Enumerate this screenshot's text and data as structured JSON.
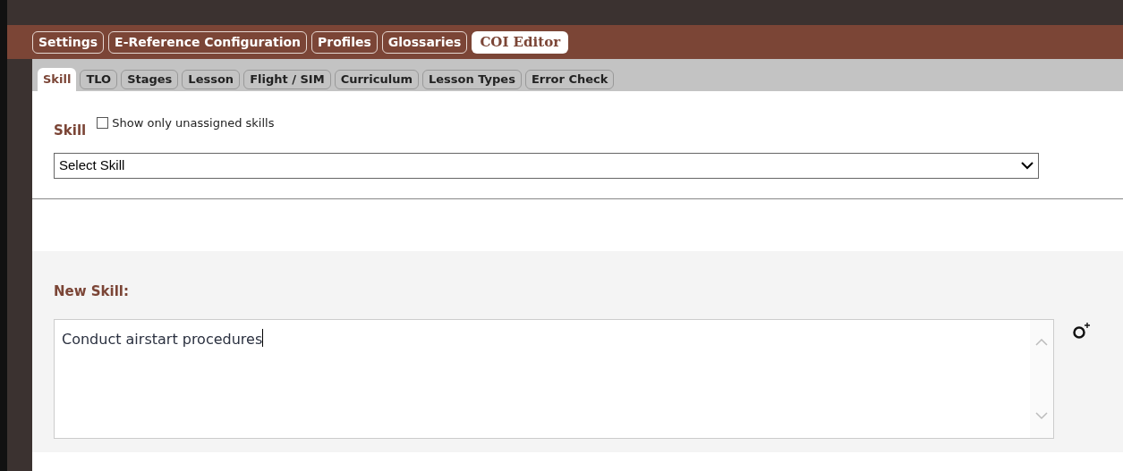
{
  "main_tabs": [
    {
      "label": "Settings",
      "selected": false
    },
    {
      "label": "E-Reference Configuration",
      "selected": false
    },
    {
      "label": "Profiles",
      "selected": false
    },
    {
      "label": "Glossaries",
      "selected": false
    },
    {
      "label": "COI Editor",
      "selected": true
    }
  ],
  "sub_tabs": [
    {
      "label": "Skill",
      "selected": true
    },
    {
      "label": "TLO",
      "selected": false
    },
    {
      "label": "Stages",
      "selected": false
    },
    {
      "label": "Lesson",
      "selected": false
    },
    {
      "label": "Flight / SIM",
      "selected": false
    },
    {
      "label": "Curriculum",
      "selected": false
    },
    {
      "label": "Lesson Types",
      "selected": false
    },
    {
      "label": "Error Check",
      "selected": false
    }
  ],
  "skill": {
    "label": "Skill",
    "filter": {
      "label": "Show only unassigned skills",
      "checked": false
    },
    "select": {
      "value": "Select Skill"
    }
  },
  "new_skill": {
    "label": "New Skill:",
    "value": "Conduct airstart procedures"
  }
}
